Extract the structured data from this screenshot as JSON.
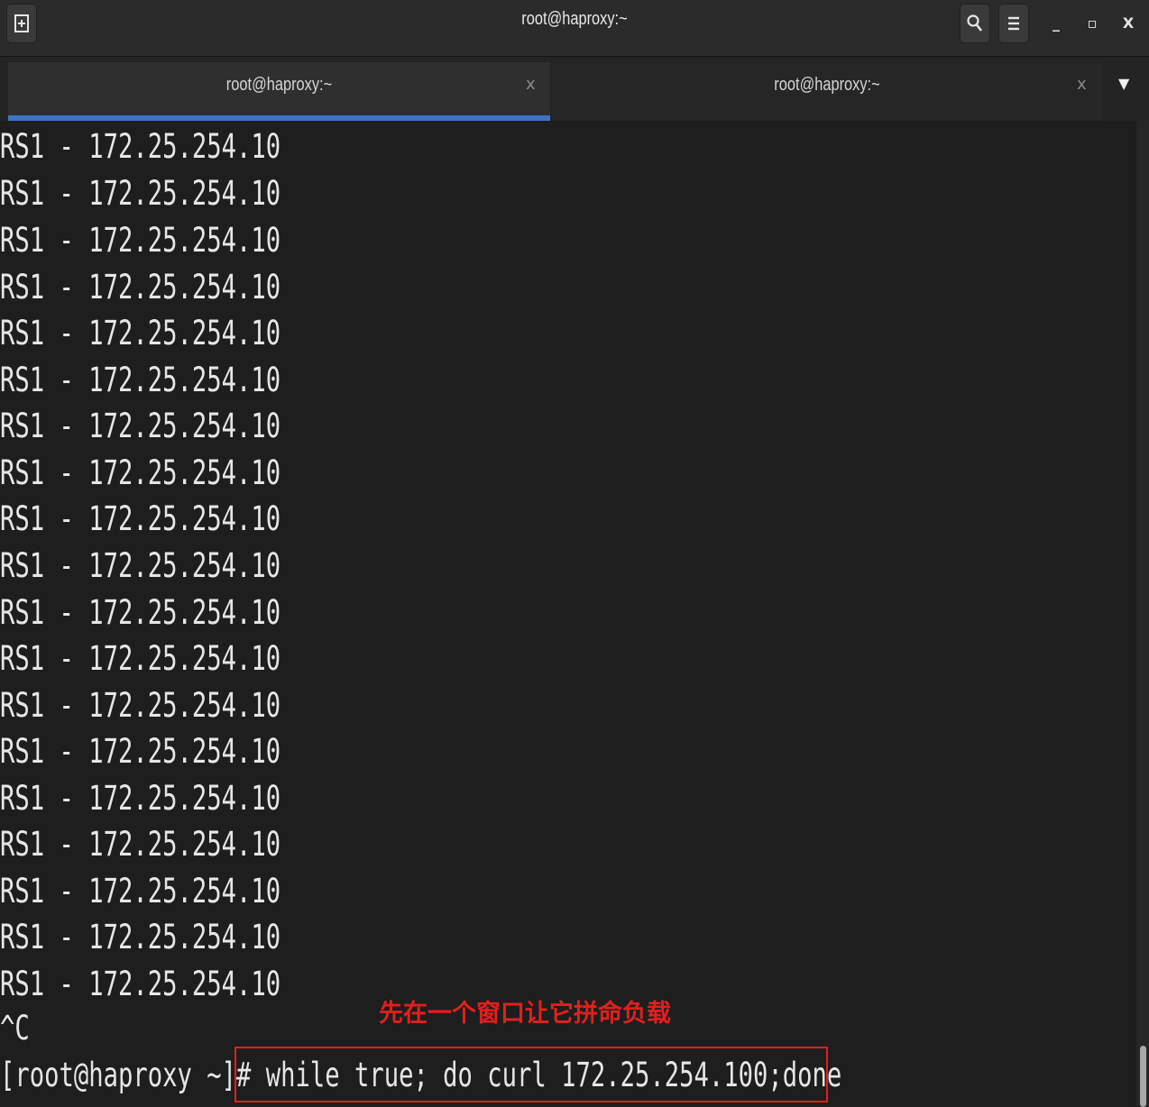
{
  "window": {
    "title": "root@haproxy:~",
    "controls": {
      "minimize": "_",
      "maximize": "▫",
      "close": "X"
    }
  },
  "icons": {
    "new_tab": "new-tab-icon",
    "search": "search-icon",
    "menu": "hamburger-menu-icon",
    "tab_close": "close-icon",
    "tab_dropdown": "chevron-down-icon"
  },
  "tabs": [
    {
      "label": "root@haproxy:~",
      "close": "x",
      "active": true
    },
    {
      "label": "root@haproxy:~",
      "close": "x",
      "active": false
    }
  ],
  "tab_dropdown_glyph": "▼",
  "colors": {
    "accent": "#3d74c4",
    "annotation": "#e0201d",
    "terminal_bg": "#1e1e1e",
    "terminal_fg": "#e6e6e6"
  },
  "terminal": {
    "lines": [
      "RS1 - 172.25.254.10",
      "RS1 - 172.25.254.10",
      "RS1 - 172.25.254.10",
      "RS1 - 172.25.254.10",
      "RS1 - 172.25.254.10",
      "RS1 - 172.25.254.10",
      "RS1 - 172.25.254.10",
      "RS1 - 172.25.254.10",
      "RS1 - 172.25.254.10",
      "RS1 - 172.25.254.10",
      "RS1 - 172.25.254.10",
      "RS1 - 172.25.254.10",
      "RS1 - 172.25.254.10",
      "RS1 - 172.25.254.10",
      "RS1 - 172.25.254.10",
      "RS1 - 172.25.254.10",
      "RS1 - 172.25.254.10",
      "RS1 - 172.25.254.10",
      "RS1 - 172.25.254.10",
      "^C"
    ],
    "prompt": "[root@haproxy ~]# ",
    "command": "while true; do curl 172.25.254.100;done"
  },
  "annotation": {
    "text": "先在一个窗口让它拼命负载"
  }
}
